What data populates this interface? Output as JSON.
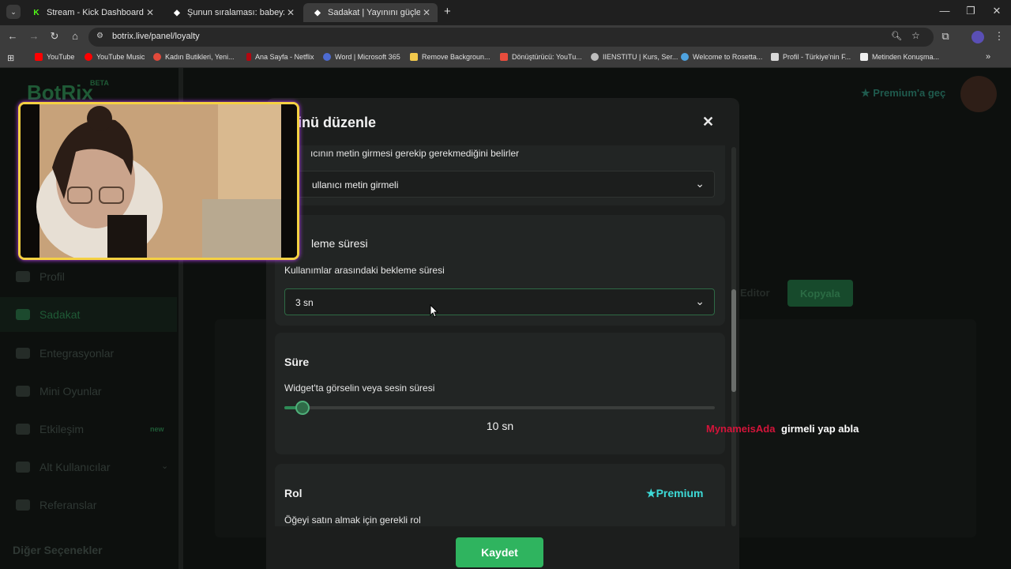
{
  "browser": {
    "tabs": [
      {
        "title": "Stream - Kick Dashboard",
        "active": false,
        "icon": "kick-logo-icon"
      },
      {
        "title": "Şunun sıralaması: babeyzos | Ya",
        "active": false,
        "icon": "botrix-diamond-icon"
      },
      {
        "title": "Sadakat | Yayınını güçlendirmel",
        "active": true,
        "icon": "botrix-diamond-icon"
      }
    ],
    "url": "botrix.live/panel/loyalty",
    "bookmarks": [
      {
        "label": "YouTube",
        "color": "#ff0000"
      },
      {
        "label": "YouTube Music",
        "color": "#ff0000"
      },
      {
        "label": "Kadın Butikleri, Yeni...",
        "color": "#e24a3b"
      },
      {
        "label": "Ana Sayfa - Netflix",
        "color": "#b20710"
      },
      {
        "label": "Word | Microsoft 365",
        "color": "#4d6bd1"
      },
      {
        "label": "Remove Backgroun...",
        "color": "#f2c94c"
      },
      {
        "label": "Dönüştürücü: YouTu...",
        "color": "#e84d3d"
      },
      {
        "label": "IIENSTITU | Kurs, Ser...",
        "color": "#bdbdbd"
      },
      {
        "label": "Welcome to Rosetta...",
        "color": "#4fa3e0"
      },
      {
        "label": "Profil - Türkiye'nin F...",
        "color": "#d8d8d8"
      },
      {
        "label": "Metinden Konuşma...",
        "color": "#f0f0f0"
      }
    ]
  },
  "page": {
    "brand": "BotRix",
    "brand_badge": "BETA",
    "premium_link": "Premium'a geç",
    "sidebar": [
      {
        "label": "Profil"
      },
      {
        "label": "Sadakat"
      },
      {
        "label": "Entegrasyonlar"
      },
      {
        "label": "Mini Oyunlar"
      },
      {
        "label": "Etkileşim",
        "badge": "new"
      },
      {
        "label": "Alt Kullanıcılar"
      },
      {
        "label": "Referanslar"
      }
    ],
    "sidebar_footer": "Diğer Seçenekler",
    "copy_label": "Kopyala",
    "bg_text": "Editor"
  },
  "modal": {
    "title": "inü düzenle",
    "close_symbol": "✕",
    "input_section": {
      "desc": "ıcının metin girmesi gerekip gerekmediğini belirler",
      "value": "ullanıcı metin girmeli"
    },
    "cooldown_section": {
      "title": "leme süresi",
      "desc": "Kullanımlar arasındaki bekleme süresi",
      "value": "3 sn"
    },
    "duration_section": {
      "title": "Süre",
      "desc": "Widget'ta görselin veya sesin süresi",
      "value_label": "10 sn",
      "slider_fraction": 0.03
    },
    "role_section": {
      "title": "Rol",
      "premium_label": "Premium",
      "desc": "Öğeyi satın almak için gerekli rol"
    },
    "save_label": "Kaydet"
  },
  "chat_overlay": {
    "username": "MynameisAda",
    "username_color": "#d4143a",
    "message": "girmeli yap abla"
  },
  "colors": {
    "accent": "#2fb45f",
    "premium": "#3ddad7"
  }
}
